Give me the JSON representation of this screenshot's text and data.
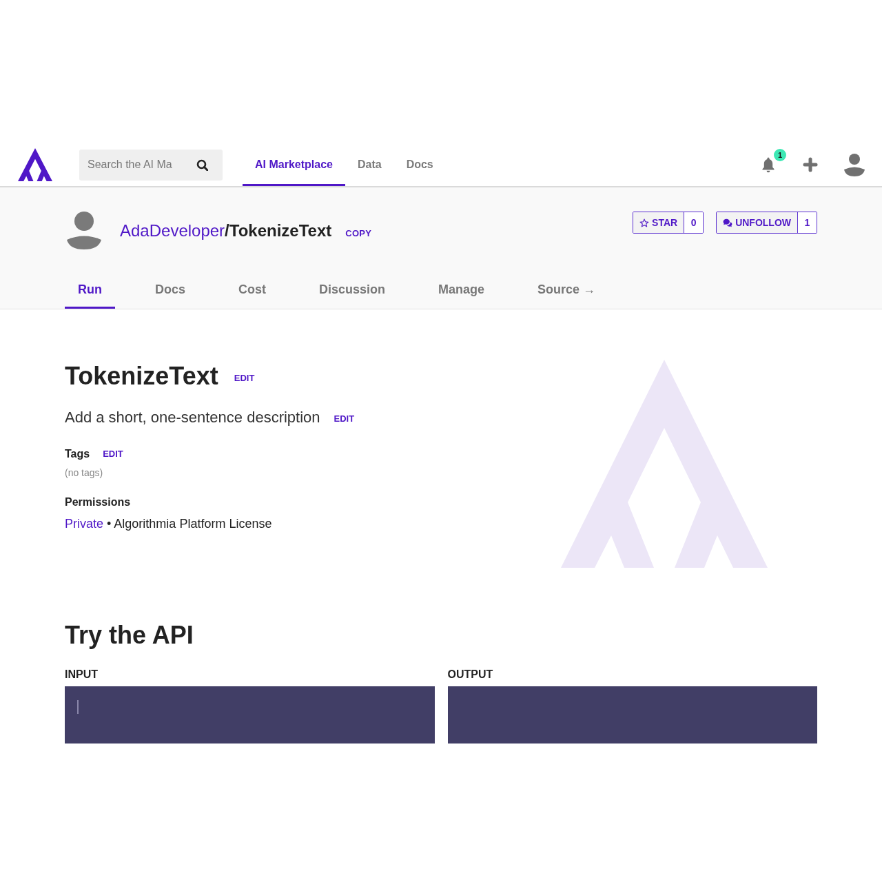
{
  "header": {
    "search": {
      "placeholder": "Search the AI Ma"
    },
    "nav": [
      {
        "label": "AI Marketplace",
        "selected": true
      },
      {
        "label": "Data",
        "selected": false
      },
      {
        "label": "Docs",
        "selected": false
      }
    ],
    "notifications": {
      "count": "1"
    }
  },
  "repo": {
    "owner": "AdaDeveloper",
    "separator": "/",
    "name": "TokenizeText",
    "copy": "COPY",
    "star": {
      "label": "STAR",
      "count": "0"
    },
    "follow": {
      "label": "UNFOLLOW",
      "count": "1"
    }
  },
  "tabs": [
    {
      "label": "Run",
      "selected": true
    },
    {
      "label": "Docs",
      "selected": false
    },
    {
      "label": "Cost",
      "selected": false
    },
    {
      "label": "Discussion",
      "selected": false
    },
    {
      "label": "Manage",
      "selected": false
    },
    {
      "label": "Source →",
      "selected": false
    }
  ],
  "details": {
    "title": "TokenizeText",
    "title_edit": "EDIT",
    "description": "Add a short, one-sentence description",
    "description_edit": "EDIT",
    "tags": {
      "label": "Tags",
      "edit": "EDIT",
      "empty": "(no tags)"
    },
    "permissions": {
      "label": "Permissions",
      "visibility": "Private",
      "separator": "•",
      "license": "Algorithmia Platform License"
    }
  },
  "api": {
    "title": "Try the API",
    "input": {
      "label": "INPUT"
    },
    "output": {
      "label": "OUTPUT"
    }
  }
}
